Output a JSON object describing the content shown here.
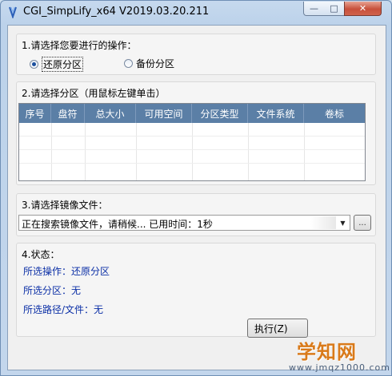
{
  "window": {
    "title": "CGI_SimpLify_x64 V2019.03.20.211",
    "controls": {
      "minimize": "—",
      "maximize": "□",
      "close": "✕"
    }
  },
  "operation": {
    "label": "1.请选择您要进行的操作：",
    "options": [
      {
        "label": "还原分区",
        "selected": true
      },
      {
        "label": "备份分区",
        "selected": false
      }
    ]
  },
  "partition": {
    "label": "2.请选择分区（用鼠标左键单击）",
    "columns": [
      "序号",
      "盘符",
      "总大小",
      "可用空间",
      "分区类型",
      "文件系统",
      "卷标"
    ]
  },
  "image": {
    "label": "3.请选择镜像文件：",
    "combo_value": "正在搜索镜像文件，请稍候...    已用时间：1秒",
    "browse_label": "..."
  },
  "status": {
    "label": "4.状态：",
    "lines": [
      "所选操作：还原分区",
      "所选分区：无",
      "所选路径/文件：无"
    ]
  },
  "execute_button": "执行(Z)",
  "watermark": {
    "text": "学知网",
    "url": "www.jmqz1000.com"
  },
  "colors": {
    "table_header": "#5b7fa6",
    "status_text": "#0b2fa6"
  }
}
